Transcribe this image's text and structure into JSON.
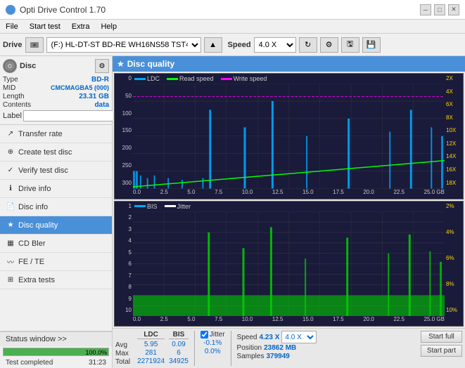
{
  "app": {
    "title": "Opti Drive Control 1.70",
    "title_icon": "●"
  },
  "title_buttons": {
    "minimize": "─",
    "maximize": "□",
    "close": "✕"
  },
  "menu": {
    "items": [
      "File",
      "Start test",
      "Extra",
      "Help"
    ]
  },
  "drive_bar": {
    "label": "Drive",
    "drive_value": "(F:)  HL-DT-ST BD-RE  WH16NS58 TST4",
    "speed_label": "Speed",
    "speed_value": "4.0 X"
  },
  "disc": {
    "type_label": "Type",
    "type_value": "BD-R",
    "mid_label": "MID",
    "mid_value": "CMCMAGBA5 (000)",
    "length_label": "Length",
    "length_value": "23.31 GB",
    "contents_label": "Contents",
    "contents_value": "data",
    "label_label": "Label",
    "label_placeholder": ""
  },
  "nav": {
    "items": [
      {
        "id": "transfer-rate",
        "label": "Transfer rate",
        "icon": "↗"
      },
      {
        "id": "create-test-disc",
        "label": "Create test disc",
        "icon": "⊕"
      },
      {
        "id": "verify-test-disc",
        "label": "Verify test disc",
        "icon": "✓"
      },
      {
        "id": "drive-info",
        "label": "Drive info",
        "icon": "ℹ"
      },
      {
        "id": "disc-info",
        "label": "Disc info",
        "icon": "📄"
      },
      {
        "id": "disc-quality",
        "label": "Disc quality",
        "icon": "★",
        "active": true
      },
      {
        "id": "cd-bler",
        "label": "CD Bler",
        "icon": "▦"
      },
      {
        "id": "fe-te",
        "label": "FE / TE",
        "icon": "〰"
      },
      {
        "id": "extra-tests",
        "label": "Extra tests",
        "icon": "⊞"
      }
    ]
  },
  "status": {
    "window_label": "Status window >>",
    "progress": 100,
    "progress_text": "100.0%",
    "status_text": "Test completed",
    "time_text": "31:23"
  },
  "disc_quality": {
    "title": "Disc quality",
    "icon": "★"
  },
  "chart1": {
    "title": "LDC / Read speed / Write speed",
    "legend": [
      {
        "label": "LDC",
        "color": "#00aaff"
      },
      {
        "label": "Read speed",
        "color": "#00ff00"
      },
      {
        "label": "Write speed",
        "color": "#ff00ff"
      }
    ],
    "y_left_labels": [
      "0",
      "50",
      "100",
      "150",
      "200",
      "250",
      "300"
    ],
    "y_right_labels": [
      "2X",
      "4X",
      "6X",
      "8X",
      "10X",
      "12X",
      "14X",
      "16X",
      "18X"
    ],
    "x_labels": [
      "0.0",
      "2.5",
      "5.0",
      "7.5",
      "10.0",
      "12.5",
      "15.0",
      "17.5",
      "20.0",
      "22.5",
      "25.0 GB"
    ]
  },
  "chart2": {
    "title": "BIS / Jitter",
    "legend": [
      {
        "label": "BIS",
        "color": "#00aaff"
      },
      {
        "label": "Jitter",
        "color": "#ffffff"
      }
    ],
    "y_left_labels": [
      "1",
      "2",
      "3",
      "4",
      "5",
      "6",
      "7",
      "8",
      "9",
      "10"
    ],
    "y_right_labels": [
      "2%",
      "4%",
      "6%",
      "8%",
      "10%"
    ],
    "x_labels": [
      "0.0",
      "2.5",
      "5.0",
      "7.5",
      "10.0",
      "12.5",
      "15.0",
      "17.5",
      "20.0",
      "22.5",
      "25.0 GB"
    ]
  },
  "stats": {
    "cols": {
      "ldc_header": "LDC",
      "bis_header": "BIS",
      "jitter_header": "Jitter",
      "speed_header": "Speed",
      "position_header": "Position"
    },
    "avg_label": "Avg",
    "max_label": "Max",
    "total_label": "Total",
    "ldc_avg": "5.95",
    "ldc_max": "281",
    "ldc_total": "2271924",
    "bis_avg": "0.09",
    "bis_max": "6",
    "bis_total": "34925",
    "jitter_avg": "-0.1%",
    "jitter_max": "0.0%",
    "jitter_total": "",
    "speed_label": "Speed",
    "speed_value": "4.23 X",
    "speed_select": "4.0 X",
    "position_label": "Position",
    "position_value": "23862 MB",
    "samples_label": "Samples",
    "samples_value": "379949",
    "btn_start_full": "Start full",
    "btn_start_part": "Start part"
  }
}
